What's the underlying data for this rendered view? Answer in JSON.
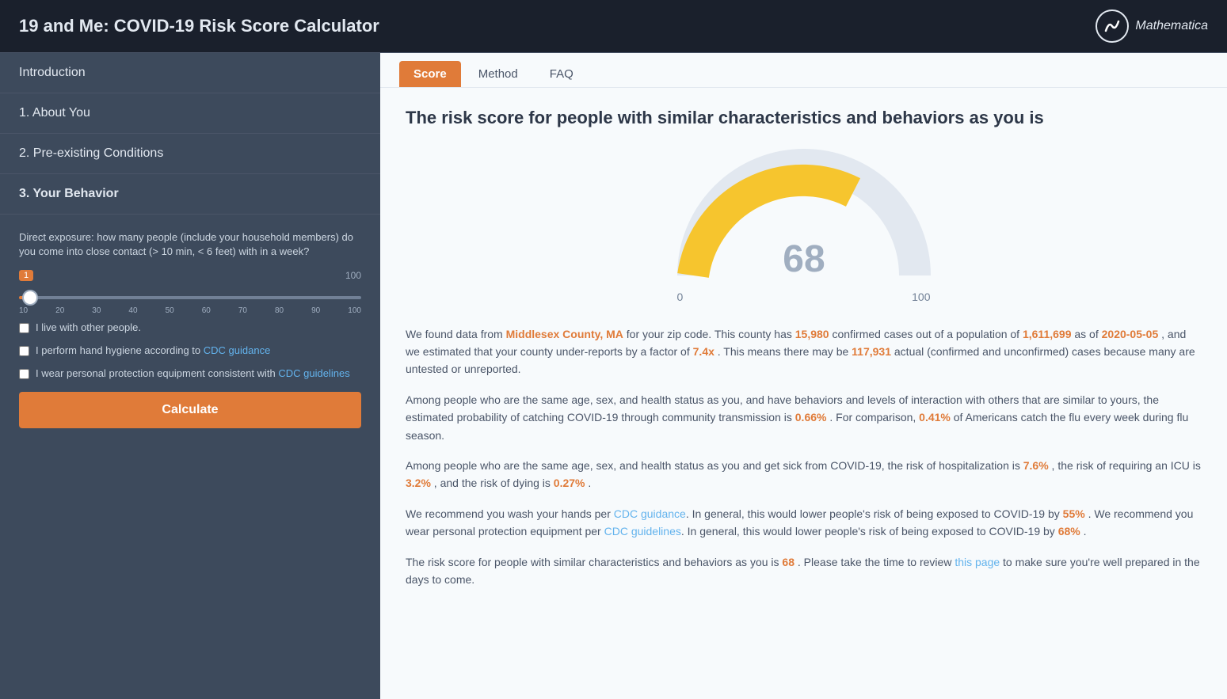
{
  "header": {
    "title": "19 and Me: COVID-19 Risk Score Calculator",
    "logo_letter": "m",
    "logo_brand": "Mathematica"
  },
  "left_panel": {
    "nav_items": [
      {
        "id": "intro",
        "label": "Introduction",
        "active": false
      },
      {
        "id": "about",
        "label": "1. About You",
        "active": false
      },
      {
        "id": "conditions",
        "label": "2. Pre-existing Conditions",
        "active": false
      },
      {
        "id": "behavior",
        "label": "3. Your Behavior",
        "active": true
      }
    ],
    "form": {
      "question_label": "Direct exposure: how many people (include your household members) do you come into close contact (> 10 min, < 6 feet) with in a week?",
      "slider": {
        "min": 0,
        "max": 100,
        "value": 1,
        "badge_value": "1",
        "max_label": "100",
        "ticks": [
          "10",
          "20",
          "30",
          "40",
          "50",
          "60",
          "70",
          "80",
          "90",
          "100"
        ]
      },
      "checkboxes": [
        {
          "id": "live_with_others",
          "label": "I live with other people.",
          "link": null,
          "checked": false
        },
        {
          "id": "hand_hygiene",
          "label_prefix": "I perform hand hygiene according to ",
          "link_text": "CDC guidance",
          "label_suffix": "",
          "checked": false
        },
        {
          "id": "ppe",
          "label_prefix": "I wear personal protection equipment consistent with ",
          "link_text": "CDC guidelines",
          "label_suffix": "",
          "checked": false
        }
      ],
      "calculate_button": "Calculate"
    }
  },
  "right_panel": {
    "tabs": [
      {
        "id": "score",
        "label": "Score",
        "active": true
      },
      {
        "id": "method",
        "label": "Method",
        "active": false
      },
      {
        "id": "faq",
        "label": "FAQ",
        "active": false
      }
    ],
    "heading": "The risk score for people with similar characteristics and behaviors as you is",
    "gauge": {
      "value": 68,
      "min_label": "0",
      "max_label": "100",
      "filled_percent": 68
    },
    "paragraphs": [
      {
        "id": "p1",
        "parts": [
          {
            "text": "We found data from ",
            "type": "normal"
          },
          {
            "text": "Middlesex County, MA",
            "type": "orange"
          },
          {
            "text": " for your zip code. This county has ",
            "type": "normal"
          },
          {
            "text": "15,980",
            "type": "orange"
          },
          {
            "text": " confirmed cases out of a population of ",
            "type": "normal"
          },
          {
            "text": "1,611,699",
            "type": "orange"
          },
          {
            "text": " as of ",
            "type": "normal"
          },
          {
            "text": "2020-05-05",
            "type": "orange"
          },
          {
            "text": " , and we estimated that your county under-reports by a factor of ",
            "type": "normal"
          },
          {
            "text": "7.4x",
            "type": "orange"
          },
          {
            "text": " . This means there may be ",
            "type": "normal"
          },
          {
            "text": "117,931",
            "type": "orange"
          },
          {
            "text": " actual (confirmed and unconfirmed) cases because many are untested or unreported.",
            "type": "normal"
          }
        ]
      },
      {
        "id": "p2",
        "parts": [
          {
            "text": "Among people who are the same age, sex, and health status as you, and have behaviors and levels of interaction with others that are similar to yours, the estimated probability of catching COVID-19 through community transmission is ",
            "type": "normal"
          },
          {
            "text": "0.66%",
            "type": "orange"
          },
          {
            "text": " . For comparison, ",
            "type": "normal"
          },
          {
            "text": "0.41%",
            "type": "orange"
          },
          {
            "text": " of Americans catch the flu every week during flu season.",
            "type": "normal"
          }
        ]
      },
      {
        "id": "p3",
        "parts": [
          {
            "text": "Among people who are the same age, sex, and health status as you and get sick from COVID-19, the risk of hospitalization is ",
            "type": "normal"
          },
          {
            "text": "7.6%",
            "type": "orange"
          },
          {
            "text": " , the risk of requiring an ICU is ",
            "type": "normal"
          },
          {
            "text": "3.2%",
            "type": "orange"
          },
          {
            "text": " , and the risk of dying is ",
            "type": "normal"
          },
          {
            "text": "0.27%",
            "type": "orange"
          },
          {
            "text": " .",
            "type": "normal"
          }
        ]
      },
      {
        "id": "p4",
        "parts": [
          {
            "text": "We recommend you wash your hands per ",
            "type": "normal"
          },
          {
            "text": "CDC guidance",
            "type": "link"
          },
          {
            "text": ". In general, this would lower people's risk of being exposed to COVID-19 by ",
            "type": "normal"
          },
          {
            "text": "55%",
            "type": "orange"
          },
          {
            "text": " . We recommend you wear personal protection equipment per ",
            "type": "normal"
          },
          {
            "text": "CDC guidelines",
            "type": "link"
          },
          {
            "text": ". In general, this would lower people's risk of being exposed to COVID-19 by ",
            "type": "normal"
          },
          {
            "text": "68%",
            "type": "orange"
          },
          {
            "text": " .",
            "type": "normal"
          }
        ]
      },
      {
        "id": "p5",
        "parts": [
          {
            "text": "The risk score for people with similar characteristics and behaviors as you is ",
            "type": "normal"
          },
          {
            "text": "68",
            "type": "orange"
          },
          {
            "text": " . Please take the time to review ",
            "type": "normal"
          },
          {
            "text": "this page",
            "type": "link"
          },
          {
            "text": " to make sure you're well prepared in the days to come.",
            "type": "normal"
          }
        ]
      }
    ]
  }
}
